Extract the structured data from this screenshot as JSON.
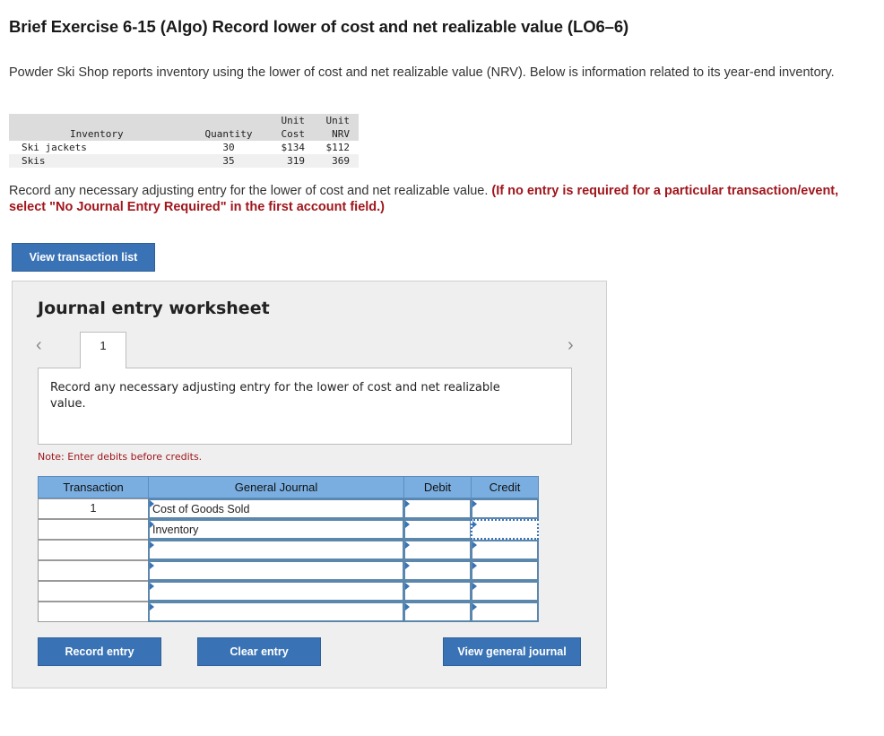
{
  "title": "Brief Exercise 6-15 (Algo) Record lower of cost and net realizable value (LO6–6)",
  "intro": "Powder Ski Shop reports inventory using the lower of cost and net realizable value (NRV). Below is information related to its year-end inventory.",
  "inventory_table": {
    "headers": {
      "item": "Inventory",
      "qty": "Quantity",
      "cost_top": "Unit",
      "cost": "Cost",
      "nrv_top": "Unit",
      "nrv": "NRV"
    },
    "rows": [
      {
        "item": "Ski jackets",
        "qty": "30",
        "cost": "$134",
        "nrv": "$112"
      },
      {
        "item": "Skis",
        "qty": "35",
        "cost": "319",
        "nrv": "369"
      }
    ]
  },
  "instructions": {
    "main": "Record any necessary adjusting entry for the lower of cost and net realizable value. ",
    "highlight": "(If no entry is required for a particular transaction/event, select \"No Journal Entry Required\" in the first account field.)"
  },
  "buttons": {
    "view_transaction_list": "View transaction list",
    "record_entry": "Record entry",
    "clear_entry": "Clear entry",
    "view_general_journal": "View general journal"
  },
  "worksheet": {
    "title": "Journal entry worksheet",
    "prev_icon": "chevron-left-icon",
    "next_icon": "chevron-right-icon",
    "tab_label": "1",
    "description": "Record any necessary adjusting entry for the lower of cost and net realizable value.",
    "note": "Note: Enter debits before credits."
  },
  "journal": {
    "headers": {
      "transaction": "Transaction",
      "account": "General Journal",
      "debit": "Debit",
      "credit": "Credit"
    },
    "rows": [
      {
        "transaction": "1",
        "account": "Cost of Goods Sold",
        "debit": "",
        "credit": ""
      },
      {
        "transaction": "",
        "account": "Inventory",
        "debit": "",
        "credit": ""
      },
      {
        "transaction": "",
        "account": "",
        "debit": "",
        "credit": ""
      },
      {
        "transaction": "",
        "account": "",
        "debit": "",
        "credit": ""
      },
      {
        "transaction": "",
        "account": "",
        "debit": "",
        "credit": ""
      },
      {
        "transaction": "",
        "account": "",
        "debit": "",
        "credit": ""
      }
    ]
  },
  "colors": {
    "button_blue": "#3a73b5",
    "header_blue": "#7aaee0",
    "note_red": "#a0161c"
  }
}
